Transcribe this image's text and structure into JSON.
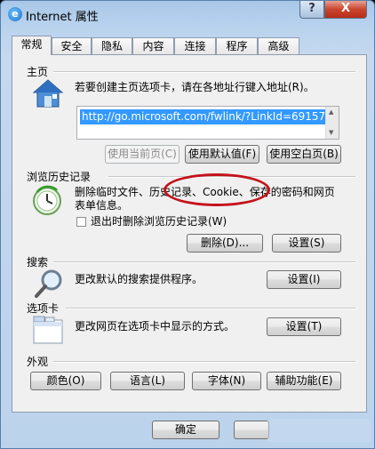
{
  "window": {
    "title": "Internet 属性",
    "help_label": "?",
    "close_label": "X"
  },
  "tabs": [
    {
      "label": "常规"
    },
    {
      "label": "安全"
    },
    {
      "label": "隐私"
    },
    {
      "label": "内容"
    },
    {
      "label": "连接"
    },
    {
      "label": "程序"
    },
    {
      "label": "高级"
    }
  ],
  "home": {
    "title": "主页",
    "description": "若要创建主页选项卡，请在各地址行键入地址(R)。",
    "url": "http://go.microsoft.com/fwlink/?LinkId=69157",
    "use_current": "使用当前页(C)",
    "use_default": "使用默认值(F)",
    "use_blank": "使用空白页(B)"
  },
  "history": {
    "title": "浏览历史记录",
    "description_line1": "删除临时文件、历史记录、Cookie、保存的密码和网页",
    "description_line2": "表单信息。",
    "checkbox_label": "退出时删除浏览历史记录(W)",
    "delete_button": "删除(D)...",
    "settings_button": "设置(S)"
  },
  "search": {
    "title": "搜索",
    "description": "更改默认的搜索提供程序。",
    "settings_button": "设置(I)"
  },
  "tabs_section": {
    "title": "选项卡",
    "description": "更改网页在选项卡中显示的方式。",
    "settings_button": "设置(T)"
  },
  "appearance": {
    "title": "外观",
    "colors": "颜色(O)",
    "languages": "语言(L)",
    "fonts": "字体(N)",
    "accessibility": "辅助功能(E)"
  },
  "footer": {
    "ok": "确定"
  }
}
